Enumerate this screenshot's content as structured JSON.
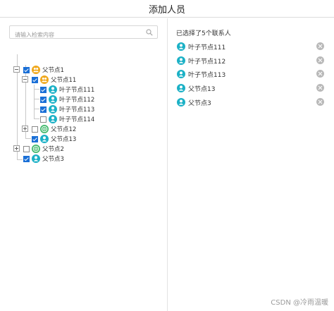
{
  "header": {
    "title": "添加人员"
  },
  "search": {
    "placeholder": "请输入检索内容",
    "value": ""
  },
  "tree": {
    "nodes": [
      {
        "label": "父节点1",
        "checked": true,
        "icon": "group-icon-orange"
      },
      {
        "label": "父节点11",
        "checked": true,
        "icon": "group-icon-orange"
      },
      {
        "label": "叶子节点111",
        "checked": true,
        "icon": "person-icon"
      },
      {
        "label": "叶子节点112",
        "checked": true,
        "icon": "person-icon"
      },
      {
        "label": "叶子节点113",
        "checked": true,
        "icon": "person-icon"
      },
      {
        "label": "叶子节点114",
        "checked": false,
        "icon": "person-icon"
      },
      {
        "label": "父节点12",
        "checked": false,
        "icon": "group-icon-green"
      },
      {
        "label": "父节点13",
        "checked": true,
        "icon": "person-icon"
      },
      {
        "label": "父节点2",
        "checked": false,
        "icon": "group-icon-green"
      },
      {
        "label": "父节点3",
        "checked": true,
        "icon": "person-icon"
      }
    ]
  },
  "selected": {
    "title": "已选择了5个联系人",
    "items": [
      {
        "label": "叶子节点111"
      },
      {
        "label": "叶子节点112"
      },
      {
        "label": "叶子节点113"
      },
      {
        "label": "父节点13"
      },
      {
        "label": "父节点3"
      }
    ]
  },
  "colors": {
    "checkbox": "#1a6fd6",
    "group_orange": "#f0a81c",
    "group_green": "#3fb86b",
    "person": "#1cb1c6",
    "remove": "#b9b9b9"
  },
  "watermark": "CSDN @冷雨温暖"
}
